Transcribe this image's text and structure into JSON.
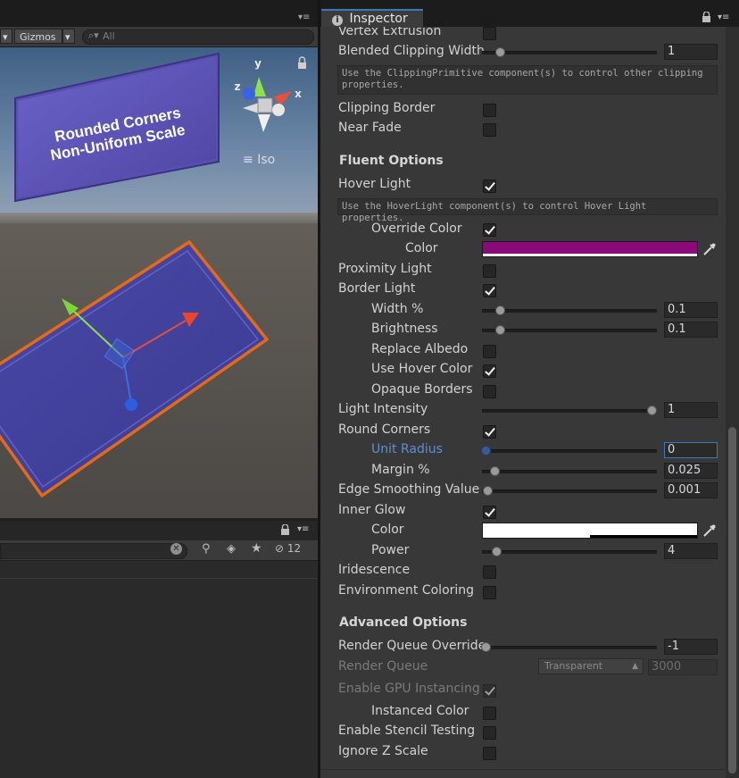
{
  "scene": {
    "gizmos_label": "Gizmos",
    "search_placeholder": "All",
    "card_title": "Rounded Corners\nNon-Uniform Scale",
    "axis_y": "y",
    "axis_x": "x",
    "axis_z": "z",
    "iso_label": "Iso"
  },
  "hierarchy": {
    "hidden_count": "12"
  },
  "inspector": {
    "tab_title": "Inspector",
    "rows": {
      "vertex_extrusion": {
        "label": "Vertex Extrusion",
        "checked": false
      },
      "blended_clipping_width": {
        "label": "Blended Clipping Width",
        "value": "1",
        "slider": 0.1
      },
      "clipping_help": "Use the ClippingPrimitive component(s) to control other clipping properties.",
      "clipping_border": {
        "label": "Clipping Border",
        "checked": false
      },
      "near_fade": {
        "label": "Near Fade",
        "checked": false
      },
      "fluent_header": "Fluent Options",
      "hover_light": {
        "label": "Hover Light",
        "checked": true
      },
      "hover_help": "Use the HoverLight component(s) to control Hover Light properties.",
      "override_color": {
        "label": "Override Color",
        "checked": true
      },
      "hover_color": {
        "label": "Color",
        "color": "#8b0a7a"
      },
      "proximity_light": {
        "label": "Proximity Light",
        "checked": false
      },
      "border_light": {
        "label": "Border Light",
        "checked": true
      },
      "width_pct": {
        "label": "Width %",
        "value": "0.1",
        "slider": 0.1
      },
      "brightness": {
        "label": "Brightness",
        "value": "0.1",
        "slider": 0.1
      },
      "replace_albedo": {
        "label": "Replace Albedo",
        "checked": false
      },
      "use_hover_color": {
        "label": "Use Hover Color",
        "checked": true
      },
      "opaque_borders": {
        "label": "Opaque Borders",
        "checked": false
      },
      "light_intensity": {
        "label": "Light Intensity",
        "value": "1",
        "slider": 0.97
      },
      "round_corners": {
        "label": "Round Corners",
        "checked": true
      },
      "unit_radius": {
        "label": "Unit Radius",
        "value": "0",
        "slider": 0.02
      },
      "margin_pct": {
        "label": "Margin %",
        "value": "0.025",
        "slider": 0.07
      },
      "edge_smoothing": {
        "label": "Edge Smoothing Value",
        "value": "0.001",
        "slider": 0.03
      },
      "inner_glow": {
        "label": "Inner Glow",
        "checked": true
      },
      "glow_color": {
        "label": "Color",
        "color": "#ffffff"
      },
      "power": {
        "label": "Power",
        "value": "4",
        "slider": 0.08
      },
      "iridescence": {
        "label": "Iridescence",
        "checked": false
      },
      "environment_coloring": {
        "label": "Environment Coloring",
        "checked": false
      },
      "advanced_header": "Advanced Options",
      "render_queue_override": {
        "label": "Render Queue Override",
        "value": "-1",
        "slider": 0.02
      },
      "render_queue": {
        "label": "Render Queue",
        "dropdown": "Transparent",
        "value": "3000"
      },
      "gpu_instancing": {
        "label": "Enable GPU Instancing",
        "checked": true
      },
      "instanced_color": {
        "label": "Instanced Color",
        "checked": false
      },
      "stencil_testing": {
        "label": "Enable Stencil Testing",
        "checked": false
      },
      "ignore_z_scale": {
        "label": "Ignore Z Scale",
        "checked": false
      }
    }
  },
  "colors": {
    "accent_blue": "#3a79bb",
    "card_purple": "#5a4fb0",
    "outline_orange": "#e46a1a"
  }
}
